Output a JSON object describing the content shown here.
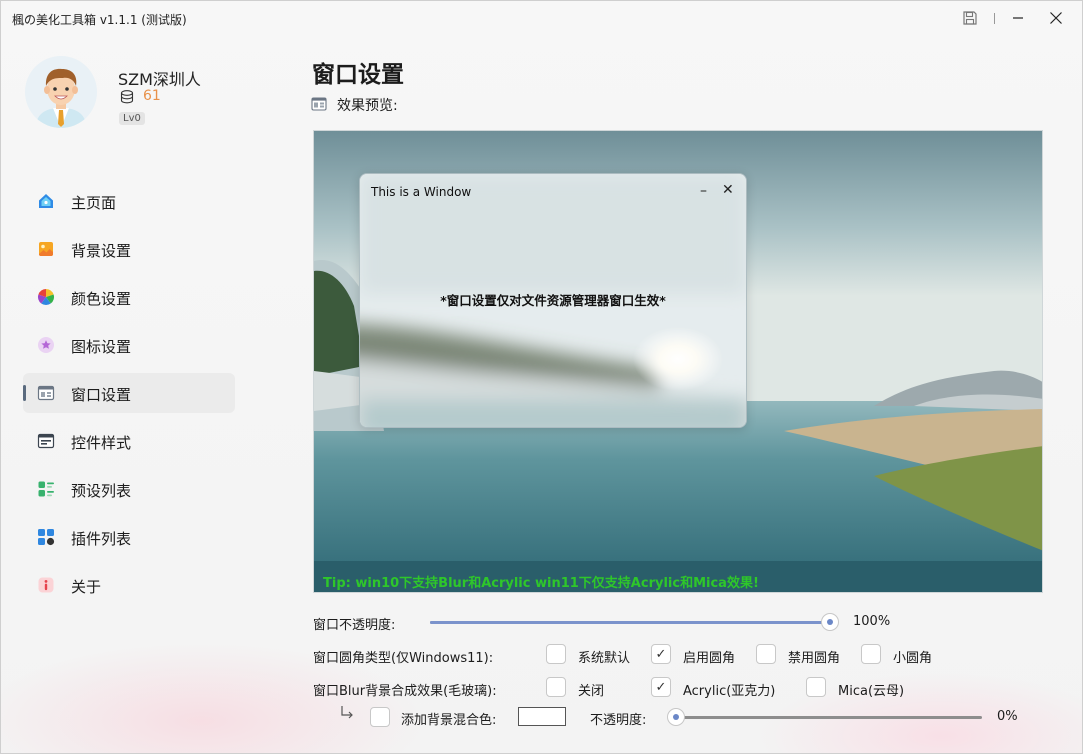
{
  "app": {
    "title": "楓の美化工具箱 v1.1.1 (测试版)"
  },
  "user": {
    "name": "SZM深圳人",
    "coins": "61",
    "level": "Lv0"
  },
  "nav": [
    {
      "label": "主页面",
      "icon": "home-icon"
    },
    {
      "label": "背景设置",
      "icon": "image-icon"
    },
    {
      "label": "颜色设置",
      "icon": "color-wheel-icon"
    },
    {
      "label": "图标设置",
      "icon": "star-icon"
    },
    {
      "label": "窗口设置",
      "icon": "window-icon",
      "active": true
    },
    {
      "label": "控件样式",
      "icon": "controls-icon"
    },
    {
      "label": "预设列表",
      "icon": "list-icon"
    },
    {
      "label": "插件列表",
      "icon": "plugins-icon"
    },
    {
      "label": "关于",
      "icon": "info-icon"
    }
  ],
  "page": {
    "title": "窗口设置",
    "preview_label": "效果预览:",
    "demo_window_title": "This is a Window",
    "demo_window_text": "*窗口设置仅对文件资源管理器窗口生效*",
    "tip": "Tip: win10下支持Blur和Acrylic win11下仅支持Acrylic和Mica效果!"
  },
  "opacity": {
    "label": "窗口不透明度:",
    "value": 100,
    "display": "100%"
  },
  "corner": {
    "label": "窗口圆角类型(仅Windows11):",
    "options": [
      {
        "label": "系统默认",
        "checked": false
      },
      {
        "label": "启用圆角",
        "checked": true
      },
      {
        "label": "禁用圆角",
        "checked": false
      },
      {
        "label": "小圆角",
        "checked": false
      }
    ]
  },
  "blur": {
    "label": "窗口Blur背景合成效果(毛玻璃):",
    "options": [
      {
        "label": "关闭",
        "checked": false
      },
      {
        "label": "Acrylic(亚克力)",
        "checked": true
      },
      {
        "label": "Mica(云母)",
        "checked": false
      }
    ]
  },
  "blend": {
    "label": "添加背景混合色:",
    "checked": false,
    "color": "#ffffff",
    "opacity_label": "不透明度:",
    "opacity_value": 0,
    "opacity_display": "0%"
  },
  "colors": {
    "accent": "#7b93cc",
    "coins": "#e8914a",
    "tip": "#2ec72a"
  }
}
